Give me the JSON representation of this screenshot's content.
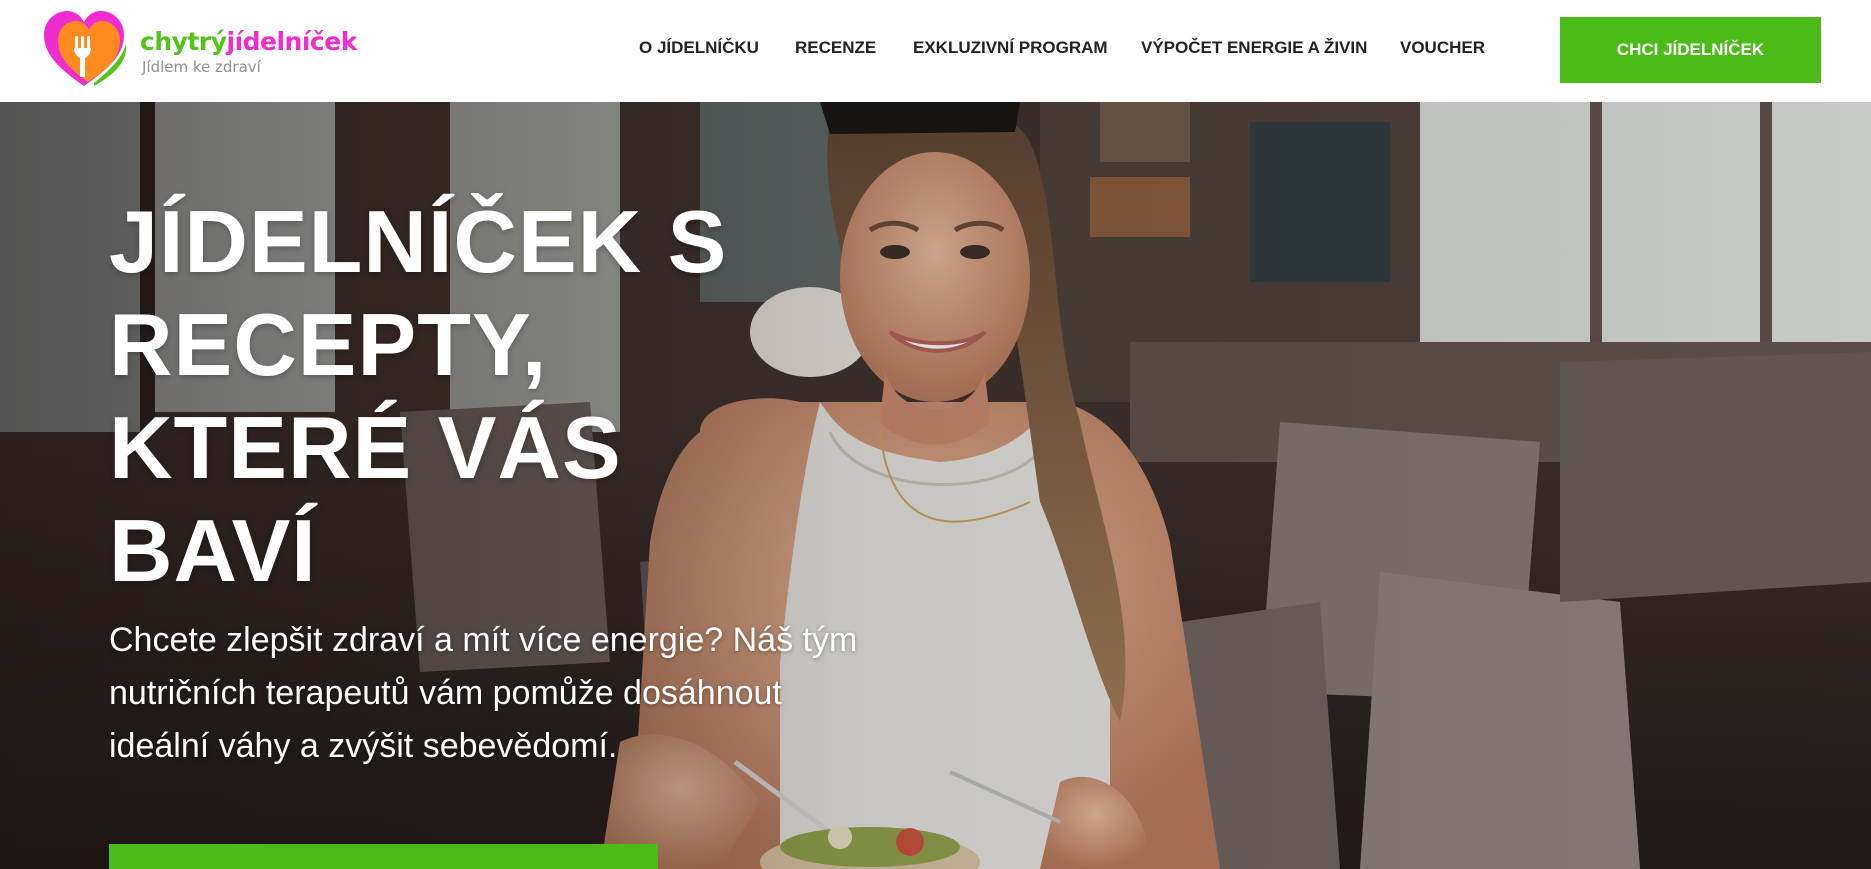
{
  "logo": {
    "name_part1": "chytrý",
    "name_part2": "jídelníček",
    "tagline": "Jídlem ke zdraví",
    "colors": {
      "green": "#52c41a",
      "orange": "#ff8a1f",
      "pink": "#ee2ccf"
    }
  },
  "nav": {
    "items": [
      {
        "label": "O JÍDELNÍČKU"
      },
      {
        "label": "RECENZE"
      },
      {
        "label": "EXKLUZIVNÍ PROGRAM"
      },
      {
        "label": "VÝPOČET ENERGIE A ŽIVIN"
      },
      {
        "label": "VOUCHER"
      }
    ],
    "cta_label": "CHCI JÍDELNÍČEK"
  },
  "hero": {
    "title_lines": [
      "JÍDELNÍČEK S",
      "RECEPTY,",
      "KTERÉ VÁS",
      "BAVÍ"
    ],
    "subtitle_lines": [
      "Chcete zlepšit zdraví a mít více energie? Náš tým",
      "nutričních terapeutů vám pomůže dosáhnout",
      "ideální váhy a zvýšit sebevědomí."
    ]
  },
  "colors": {
    "accent": "#4cbb17",
    "nav_text": "#222222"
  }
}
